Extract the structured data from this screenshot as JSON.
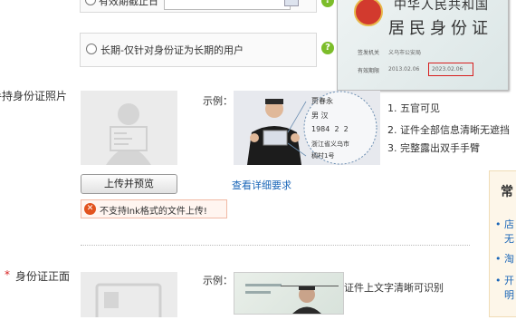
{
  "top_option": {
    "label": "有效期截止日",
    "input_value": ""
  },
  "long_option": {
    "label": "长期-仅针对身份证为长期的用户",
    "help": "?"
  },
  "id_card_back": {
    "line1": "中华人民共和国",
    "line2": "居民身份证",
    "issuer_label": "签发机关",
    "issuer_value": "义乌市公安局",
    "validity_label": "有效期限",
    "validity_start": "2013.02.06",
    "validity_end": "2023.02.06"
  },
  "hand_photo": {
    "section_label": "手持身份证照片",
    "example_label": "示例：",
    "card_text": [
      "贾春永",
      "男 汉",
      "1984  2  2",
      "浙江省义乌市",
      "稠村1号"
    ],
    "tips": [
      "1. 五官可见",
      "2. 证件全部信息清晰无遮挡",
      "3. 完整露出双手手臂"
    ],
    "upload_button": "上传并预览",
    "detail_link": "查看详细要求",
    "error_message": "不支持lnk格式的文件上传!"
  },
  "front_photo": {
    "required_mark": "*",
    "section_label": "身份证正面",
    "example_label": "示例：",
    "annotation": "证件上文字清晰可识别"
  },
  "side_panel": {
    "heading": "常",
    "lines": [
      "店",
      "无",
      "淘",
      "开",
      "明"
    ]
  }
}
